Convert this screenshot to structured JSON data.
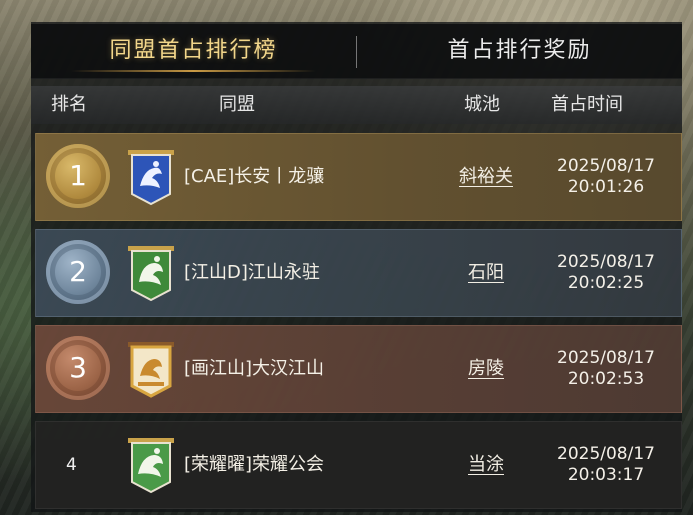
{
  "tabs": {
    "first_occupation_ranking": "同盟首占排行榜",
    "first_occupation_rewards": "首占排行奖励"
  },
  "columns": {
    "rank": "排名",
    "alliance": "同盟",
    "city": "城池",
    "first_occupation_time": "首占时间"
  },
  "rows": [
    {
      "rank": "1",
      "alliance": "[CAE]长安丨龙骧",
      "city": "斜裕关",
      "date": "2025/08/17",
      "time": "20:01:26",
      "banner_color": "#2d55b8",
      "medal": "gold"
    },
    {
      "rank": "2",
      "alliance": "[江山D]江山永驻",
      "city": "石阳",
      "date": "2025/08/17",
      "time": "20:02:25",
      "banner_color": "#3f8a3a",
      "medal": "silver"
    },
    {
      "rank": "3",
      "alliance": "[画江山]大汉江山",
      "city": "房陵",
      "date": "2025/08/17",
      "time": "20:02:53",
      "banner_color": "#d8a640",
      "medal": "bronze"
    },
    {
      "rank": "4",
      "alliance": "[荣耀曜]荣耀公会",
      "city": "当涂",
      "date": "2025/08/17",
      "time": "20:03:17",
      "banner_color": "#4a9a48",
      "medal": "none"
    }
  ],
  "colors": {
    "accent_gold": "#f2d68a",
    "row1_bg": "#78623a",
    "row2_bg": "#3c4a56",
    "row3_bg": "#6c483a",
    "row4_bg": "#242422"
  }
}
